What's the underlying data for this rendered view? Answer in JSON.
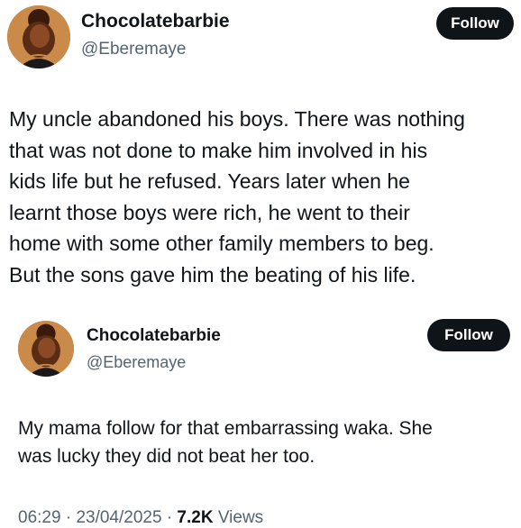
{
  "tweets": [
    {
      "display_name": "Chocolatebarbie",
      "handle": "@Eberemaye",
      "follow_label": "Follow",
      "text": "My uncle abandoned his boys. There was nothing\nthat was not done to make him involved in his\nkids life but he refused. Years later when he\nlearnt those boys were rich, he went to their\nhome with some other family members to beg.\nBut the sons gave him the beating of his life."
    },
    {
      "display_name": "Chocolatebarbie",
      "handle": "@Eberemaye",
      "follow_label": "Follow",
      "text": "My mama follow for that embarrassing waka. She\nwas lucky they did not beat her too."
    }
  ],
  "meta": {
    "time": "06:29",
    "separator": "·",
    "date": "23/04/2025",
    "views_count": "7.2K",
    "views_label": "Views"
  },
  "colors": {
    "text_primary": "#0f1419",
    "text_secondary": "#536471",
    "button_bg": "#0f1419",
    "button_text": "#ffffff"
  },
  "icons": {
    "avatar": "profile-avatar-icon"
  }
}
